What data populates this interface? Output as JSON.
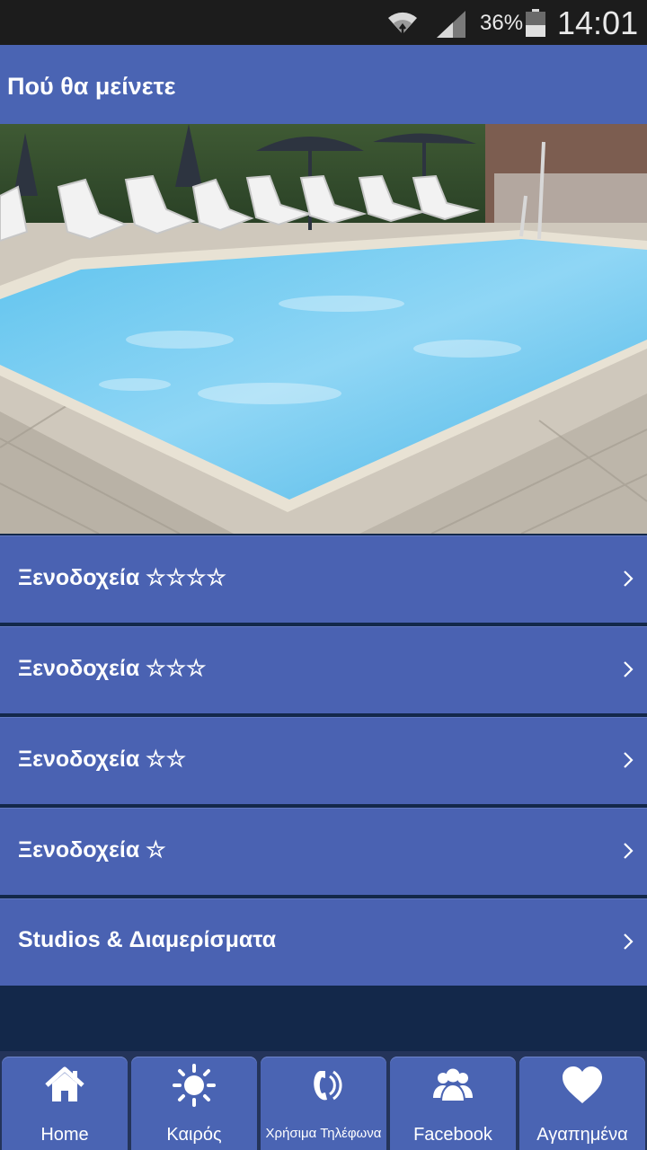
{
  "status_bar": {
    "battery": "36%",
    "time": "14:01"
  },
  "header": {
    "title": "Πού θα μείνετε"
  },
  "menu": {
    "items": [
      {
        "label": "Ξενοδοχεία ☆☆☆☆"
      },
      {
        "label": "Ξενοδοχεία ☆☆☆"
      },
      {
        "label": "Ξενοδοχεία ☆☆"
      },
      {
        "label": "Ξενοδοχεία ☆"
      },
      {
        "label": "Studios & Διαμερίσματα"
      }
    ]
  },
  "bottom_nav": {
    "items": [
      {
        "label": "Home",
        "icon": "home-icon"
      },
      {
        "label": "Καιρός",
        "icon": "sun-icon"
      },
      {
        "label": "Χρήσιμα Τηλέφωνα",
        "icon": "phone-icon"
      },
      {
        "label": "Facebook",
        "icon": "people-icon"
      },
      {
        "label": "Αγαπημένα",
        "icon": "heart-icon"
      }
    ]
  },
  "colors": {
    "accent": "#4a64b3",
    "status_bar": "#1c1c1c",
    "background": "#13284a"
  }
}
